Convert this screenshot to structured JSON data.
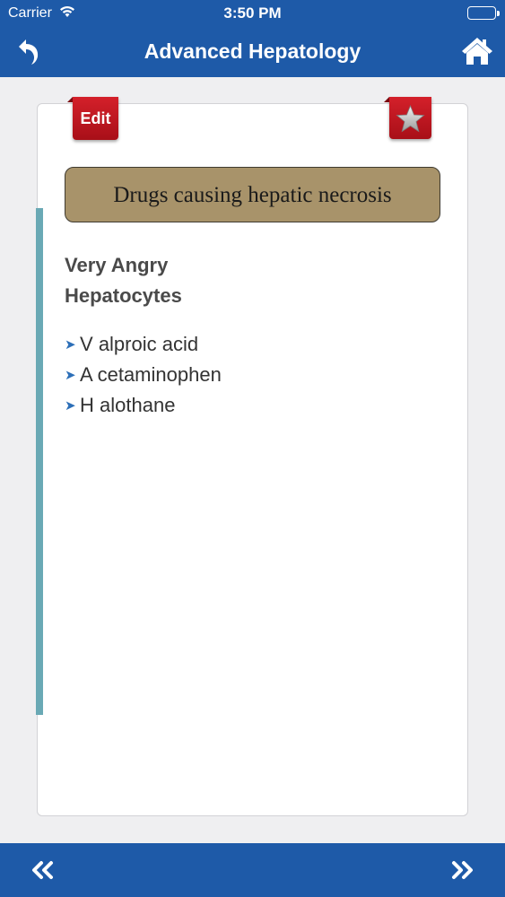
{
  "status_bar": {
    "carrier": "Carrier",
    "time": "3:50 PM",
    "battery_level": 1.0,
    "wifi_icon": "wifi-icon"
  },
  "nav_bar": {
    "title": "Advanced Hepatology",
    "back_icon": "back-arrow-icon",
    "home_icon": "home-icon",
    "color": "#1e5aa8"
  },
  "card": {
    "edit_label": "Edit",
    "favorite_icon": "star-icon",
    "topic": "Drugs causing hepatic necrosis",
    "mnemonic": [
      "Very Angry",
      "Hepatocytes"
    ],
    "items": [
      {
        "letter": "V",
        "rest": "alproic acid"
      },
      {
        "letter": "A",
        "rest": "cetaminophen"
      },
      {
        "letter": "H",
        "rest": "alothane"
      }
    ],
    "tab_color": "#c41a24",
    "topic_box_color": "#a8936a",
    "stripe_color": "#6aa9b5"
  },
  "bottom_bar": {
    "prev_icon": "double-chevron-left-icon",
    "next_icon": "double-chevron-right-icon"
  }
}
